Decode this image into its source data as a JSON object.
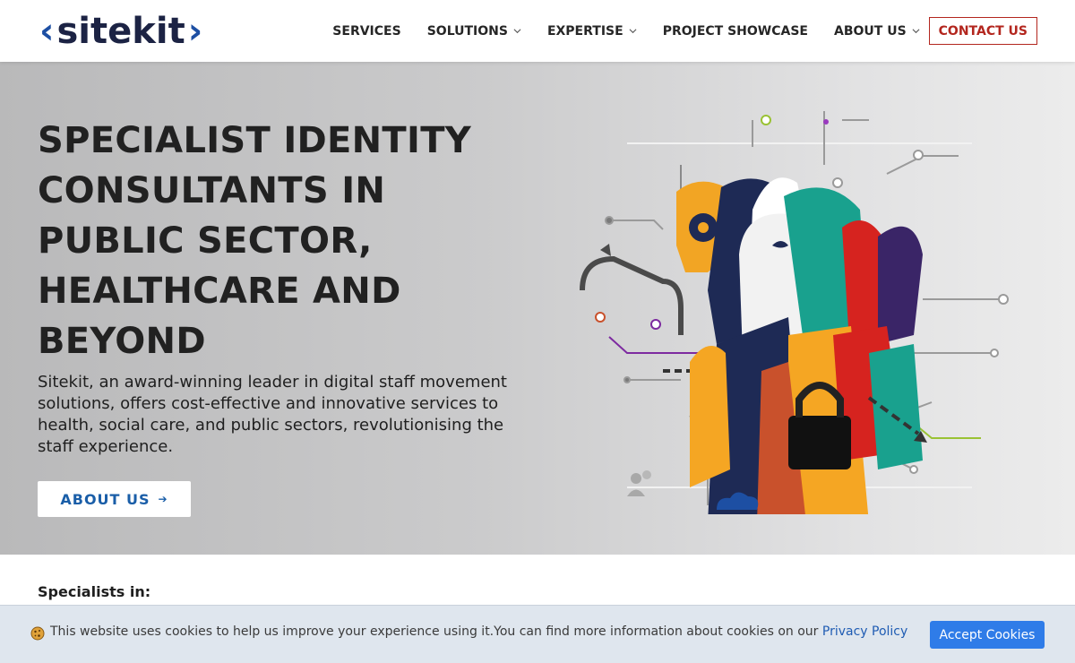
{
  "header": {
    "logo": {
      "left": "‹",
      "text": "sitekit",
      "right": "›"
    },
    "nav": [
      {
        "label": "SERVICES",
        "dropdown": false
      },
      {
        "label": "SOLUTIONS",
        "dropdown": true
      },
      {
        "label": "EXPERTISE",
        "dropdown": true
      },
      {
        "label": "PROJECT SHOWCASE",
        "dropdown": false
      },
      {
        "label": "ABOUT US",
        "dropdown": true
      }
    ],
    "contact_label": "CONTACT US"
  },
  "hero": {
    "title": "SPECIALIST IDENTITY CONSULTANTS IN PUBLIC SECTOR, HEALTHCARE AND BEYOND",
    "description": "Sitekit, an award-winning leader in digital staff movement solutions, offers cost-effective and innovative services to health, social care, and public sectors, revolutionising the staff experience.",
    "button_label": "ABOUT US",
    "button_icon": "arrow-right-icon",
    "illustration": "identity-figures-illustration"
  },
  "specialists": {
    "label": "Specialists in:"
  },
  "cookie_banner": {
    "icon": "cookie-icon",
    "text": "This website uses cookies to help us improve your experience using it.You can find more information about cookies on our ",
    "link_label": "Privacy Policy",
    "accept_label": "Accept Cookies"
  },
  "colors": {
    "brand_blue": "#1d4fa3",
    "brand_navy": "#1c2344",
    "contact_red": "#b3261e",
    "accept_blue": "#2f7ce8",
    "cookie_bg": "#dfe6ee"
  }
}
